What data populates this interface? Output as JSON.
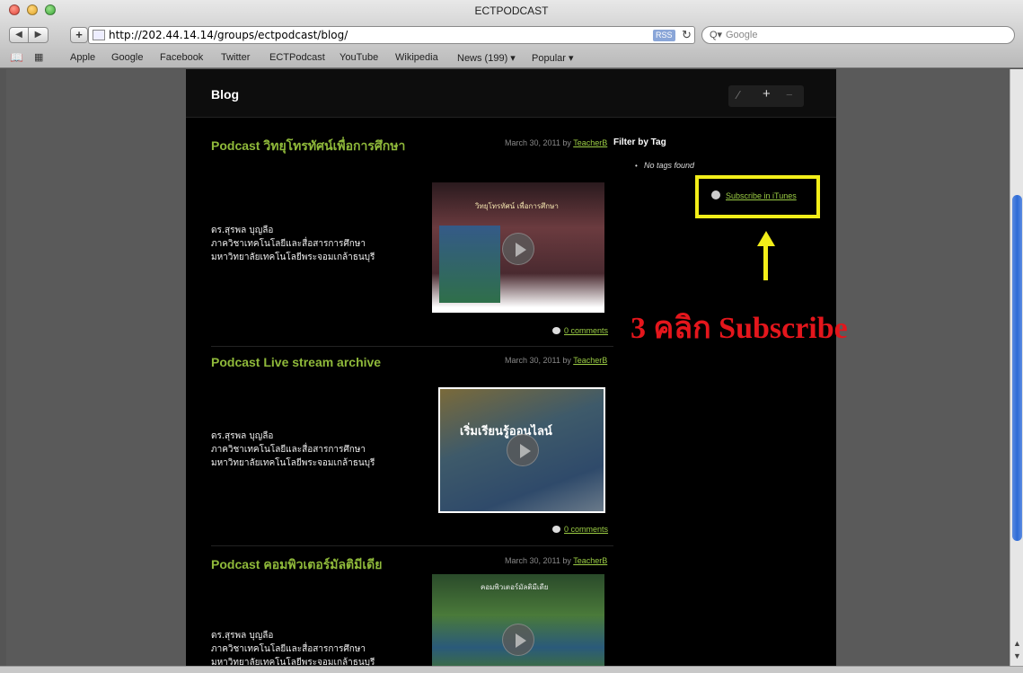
{
  "browser": {
    "window_title": "ECTPODCAST",
    "url": "http://202.44.14.14/groups/ectpodcast/blog/",
    "rss_label": "RSS",
    "search_placeholder": "Google",
    "nav_back": "◀",
    "nav_forward": "▶",
    "add_label": "+",
    "reload_icon": "reload-icon",
    "bookmarks": [
      "Apple",
      "Google",
      "Facebook",
      "Twitter",
      "ECTPodcast",
      "YouTube",
      "Wikipedia",
      "News (199) ▾",
      "Popular ▾"
    ]
  },
  "blog": {
    "title": "Blog",
    "tools": {
      "edit": "⁄",
      "add": "+",
      "remove": "−"
    },
    "posts": [
      {
        "title": "Podcast วิทยุโทรทัศน์เพื่อการศึกษา",
        "meta_prefix": "March 30, 2011 by ",
        "author": "TeacherB",
        "body": [
          "ดร.สุรพล บุญลือ",
          "ภาควิชาเทคโนโลยีและสื่อสารการศึกษา",
          "มหาวิทยาลัยเทคโนโลยีพระจอมเกล้าธนบุรี"
        ],
        "thumb_caption": "วิทยุโทรทัศน์ เพื่อการศึกษา",
        "comments": "0 comments"
      },
      {
        "title": "Podcast Live stream archive",
        "meta_prefix": "March 30, 2011 by ",
        "author": "TeacherB",
        "body": [
          "ดร.สุรพล บุญลือ",
          "ภาควิชาเทคโนโลยีและสื่อสารการศึกษา",
          "มหาวิทยาลัยเทคโนโลยีพระจอมเกล้าธนบุรี"
        ],
        "thumb_caption": "เริ่มเรียนรู้ออนไลน์",
        "comments": "0 comments"
      },
      {
        "title": "Podcast คอมพิวเตอร์มัลติมีเดีย",
        "meta_prefix": "March 30, 2011 by ",
        "author": "TeacherB",
        "body": [
          "ดร.สุรพล บุญลือ",
          "ภาควิชาเทคโนโลยีและสื่อสารการศึกษา",
          "มหาวิทยาลัยเทคโนโลยีพระจอมเกล้าธนบุรี"
        ],
        "thumb_caption": "คอมพิวเตอร์มัลติมีเดีย"
      }
    ]
  },
  "sidebar": {
    "filter_title": "Filter by Tag",
    "no_tags": "No tags found",
    "subscribe_label": "Subscribe in iTunes"
  },
  "annotation": {
    "text": "3 คลิก Subscribe",
    "highlight_color": "#f3ee19",
    "text_color": "#e4161c"
  },
  "colors": {
    "post_title": "#8fb93a",
    "link": "#9bcc44",
    "page_bg": "#000000"
  }
}
